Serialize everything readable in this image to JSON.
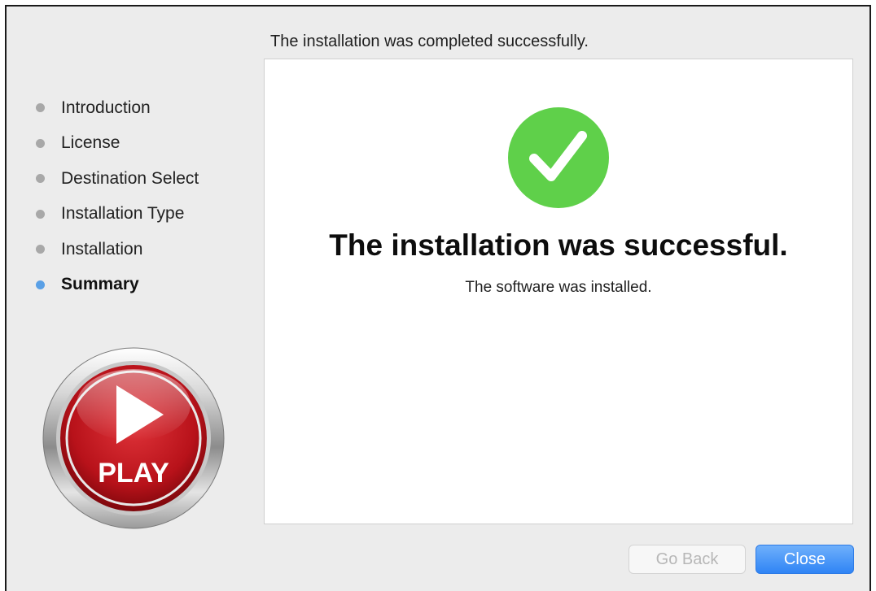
{
  "header": {
    "status_text": "The installation was completed successfully."
  },
  "sidebar": {
    "steps": [
      {
        "label": "Introduction",
        "state": "done"
      },
      {
        "label": "License",
        "state": "done"
      },
      {
        "label": "Destination Select",
        "state": "done"
      },
      {
        "label": "Installation Type",
        "state": "done"
      },
      {
        "label": "Installation",
        "state": "done"
      },
      {
        "label": "Summary",
        "state": "current"
      }
    ],
    "logo_text": "PLAY"
  },
  "main": {
    "icon": "checkmark-icon",
    "title": "The installation was successful.",
    "subtitle": "The software was installed."
  },
  "buttons": {
    "back_label": "Go Back",
    "back_enabled": false,
    "close_label": "Close"
  },
  "colors": {
    "window_background": "#ececec",
    "success_green": "#5fd04a",
    "active_step_dot": "#5aa0e6",
    "inactive_step_dot": "#a8a8a8",
    "primary_button": "#2f84f5",
    "logo_red": "#c8161d"
  }
}
